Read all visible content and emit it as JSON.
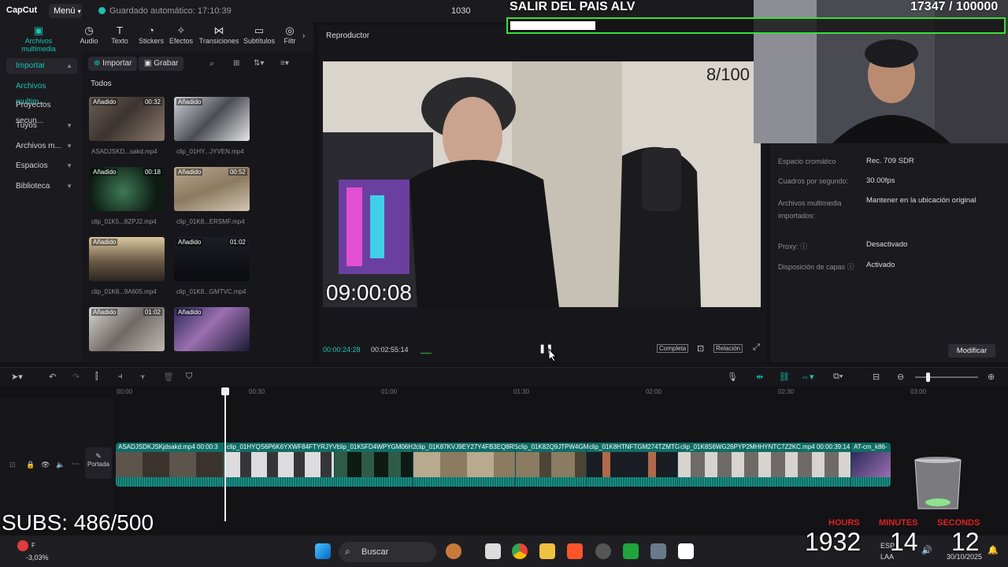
{
  "app": {
    "logo": "CapCut",
    "menu": "Menú",
    "autosave": "Guardado automático: 17:10:39",
    "resolution": "1030"
  },
  "tabs": [
    {
      "label": "Archivos multimedia",
      "icon": "media-icon"
    },
    {
      "label": "Audio",
      "icon": "audio-icon"
    },
    {
      "label": "Texto",
      "icon": "text-icon"
    },
    {
      "label": "Stickers",
      "icon": "sticker-icon"
    },
    {
      "label": "Efectos",
      "icon": "effects-icon"
    },
    {
      "label": "Transiciones",
      "icon": "transition-icon"
    },
    {
      "label": "Subtítulos",
      "icon": "subtitle-icon"
    },
    {
      "label": "Filtr",
      "icon": "filter-icon"
    }
  ],
  "nav": [
    {
      "label": "Importar"
    },
    {
      "label": "Archivos multim..."
    },
    {
      "label": "Proyectos secun..."
    },
    {
      "label": "Tuyos"
    },
    {
      "label": "Archivos m..."
    },
    {
      "label": "Espacios"
    },
    {
      "label": "Biblioteca"
    }
  ],
  "media": {
    "import_btn": "Importar",
    "record_btn": "Grabar",
    "filter_label": "Todos",
    "clips": [
      {
        "tag": "Añadido",
        "duration": "00:32",
        "name": "ASADJSKD...sakd.mp4"
      },
      {
        "tag": "Añadido",
        "duration": "",
        "name": "clip_01HY...JYVEN.mp4"
      },
      {
        "tag": "Añadido",
        "duration": "00:18",
        "name": "clip_01K5...8ZPJ2.mp4"
      },
      {
        "tag": "Añadido",
        "duration": "00:52",
        "name": "clip_01K8...ERSMF.mp4"
      },
      {
        "tag": "Añadido",
        "duration": "",
        "name": "clip_01K8...9A605.mp4"
      },
      {
        "tag": "Añadido",
        "duration": "01:02",
        "name": "clip_01K8...GMTVC.mp4"
      },
      {
        "tag": "Añadido",
        "duration": "01:02",
        "name": ""
      },
      {
        "tag": "Añadido",
        "duration": "",
        "name": ""
      }
    ]
  },
  "player": {
    "title": "Reproductor",
    "counter": "8/100",
    "clock": "09:00:08",
    "current_time": "00:00:24:28",
    "total_time": "00:02:55:14",
    "full_btn": "Completa",
    "ratio_btn": "Relación"
  },
  "details": {
    "rows": [
      {
        "label": "Espacio cromático",
        "value": "Rec. 709 SDR"
      },
      {
        "label": "Cuadros por segundo:",
        "value": "30.00fps"
      },
      {
        "label": "Archivos multimedia importados:",
        "value": "Mantener en la ubicación original"
      },
      {
        "label": "Proxy:",
        "value": "Desactivado"
      },
      {
        "label": "Disposición de capas",
        "value": "Activado"
      }
    ],
    "modify_btn": "Modificar"
  },
  "timeline": {
    "ticks": [
      "00:00",
      "00:30",
      "01:00",
      "01:30",
      "02:00",
      "02:30",
      "03:00"
    ],
    "cover_label": "Portada",
    "segments": [
      {
        "label": "ASADJSDKJSKjdsakd.mp4  00:00:3"
      },
      {
        "label": "clip_01HYQS6P6K6YXWF84FTYRJYVI"
      },
      {
        "label": "clip_01K5FD4WPYGM06H2"
      },
      {
        "label": "clip_01K87KVJ9EY27Y4FB3EQ8RS"
      },
      {
        "label": "clip_01K82Q9JTPW4GM"
      },
      {
        "label": "clip_01K8HTNFTGM274TZMTG"
      },
      {
        "label": "clip_01K8S6WG26PYP2MHHYNTC7Z2KC.mp4  00:00:39:14"
      },
      {
        "label": "AT-cm_k86-"
      }
    ]
  },
  "overlay": {
    "goal_title": "SALIR DEL PAIS ALV",
    "goal_count": "17347  / 100000",
    "goal_progress": 0.1735,
    "subs": "SUBS: 486/500",
    "timer_labels": [
      "HOURS",
      "MINUTES",
      "SECONDS"
    ],
    "timer_values": [
      "1932",
      "14",
      "12"
    ]
  },
  "taskbar": {
    "search": "Buscar",
    "lang": "ESP",
    "lang2": "LAA",
    "date": "30/10/2025",
    "stock": "-3,03%",
    "stock_label": "F"
  },
  "colors": {
    "accent": "#19c3b1",
    "goal_border": "#3adf3a",
    "timer_label": "#e02020"
  }
}
